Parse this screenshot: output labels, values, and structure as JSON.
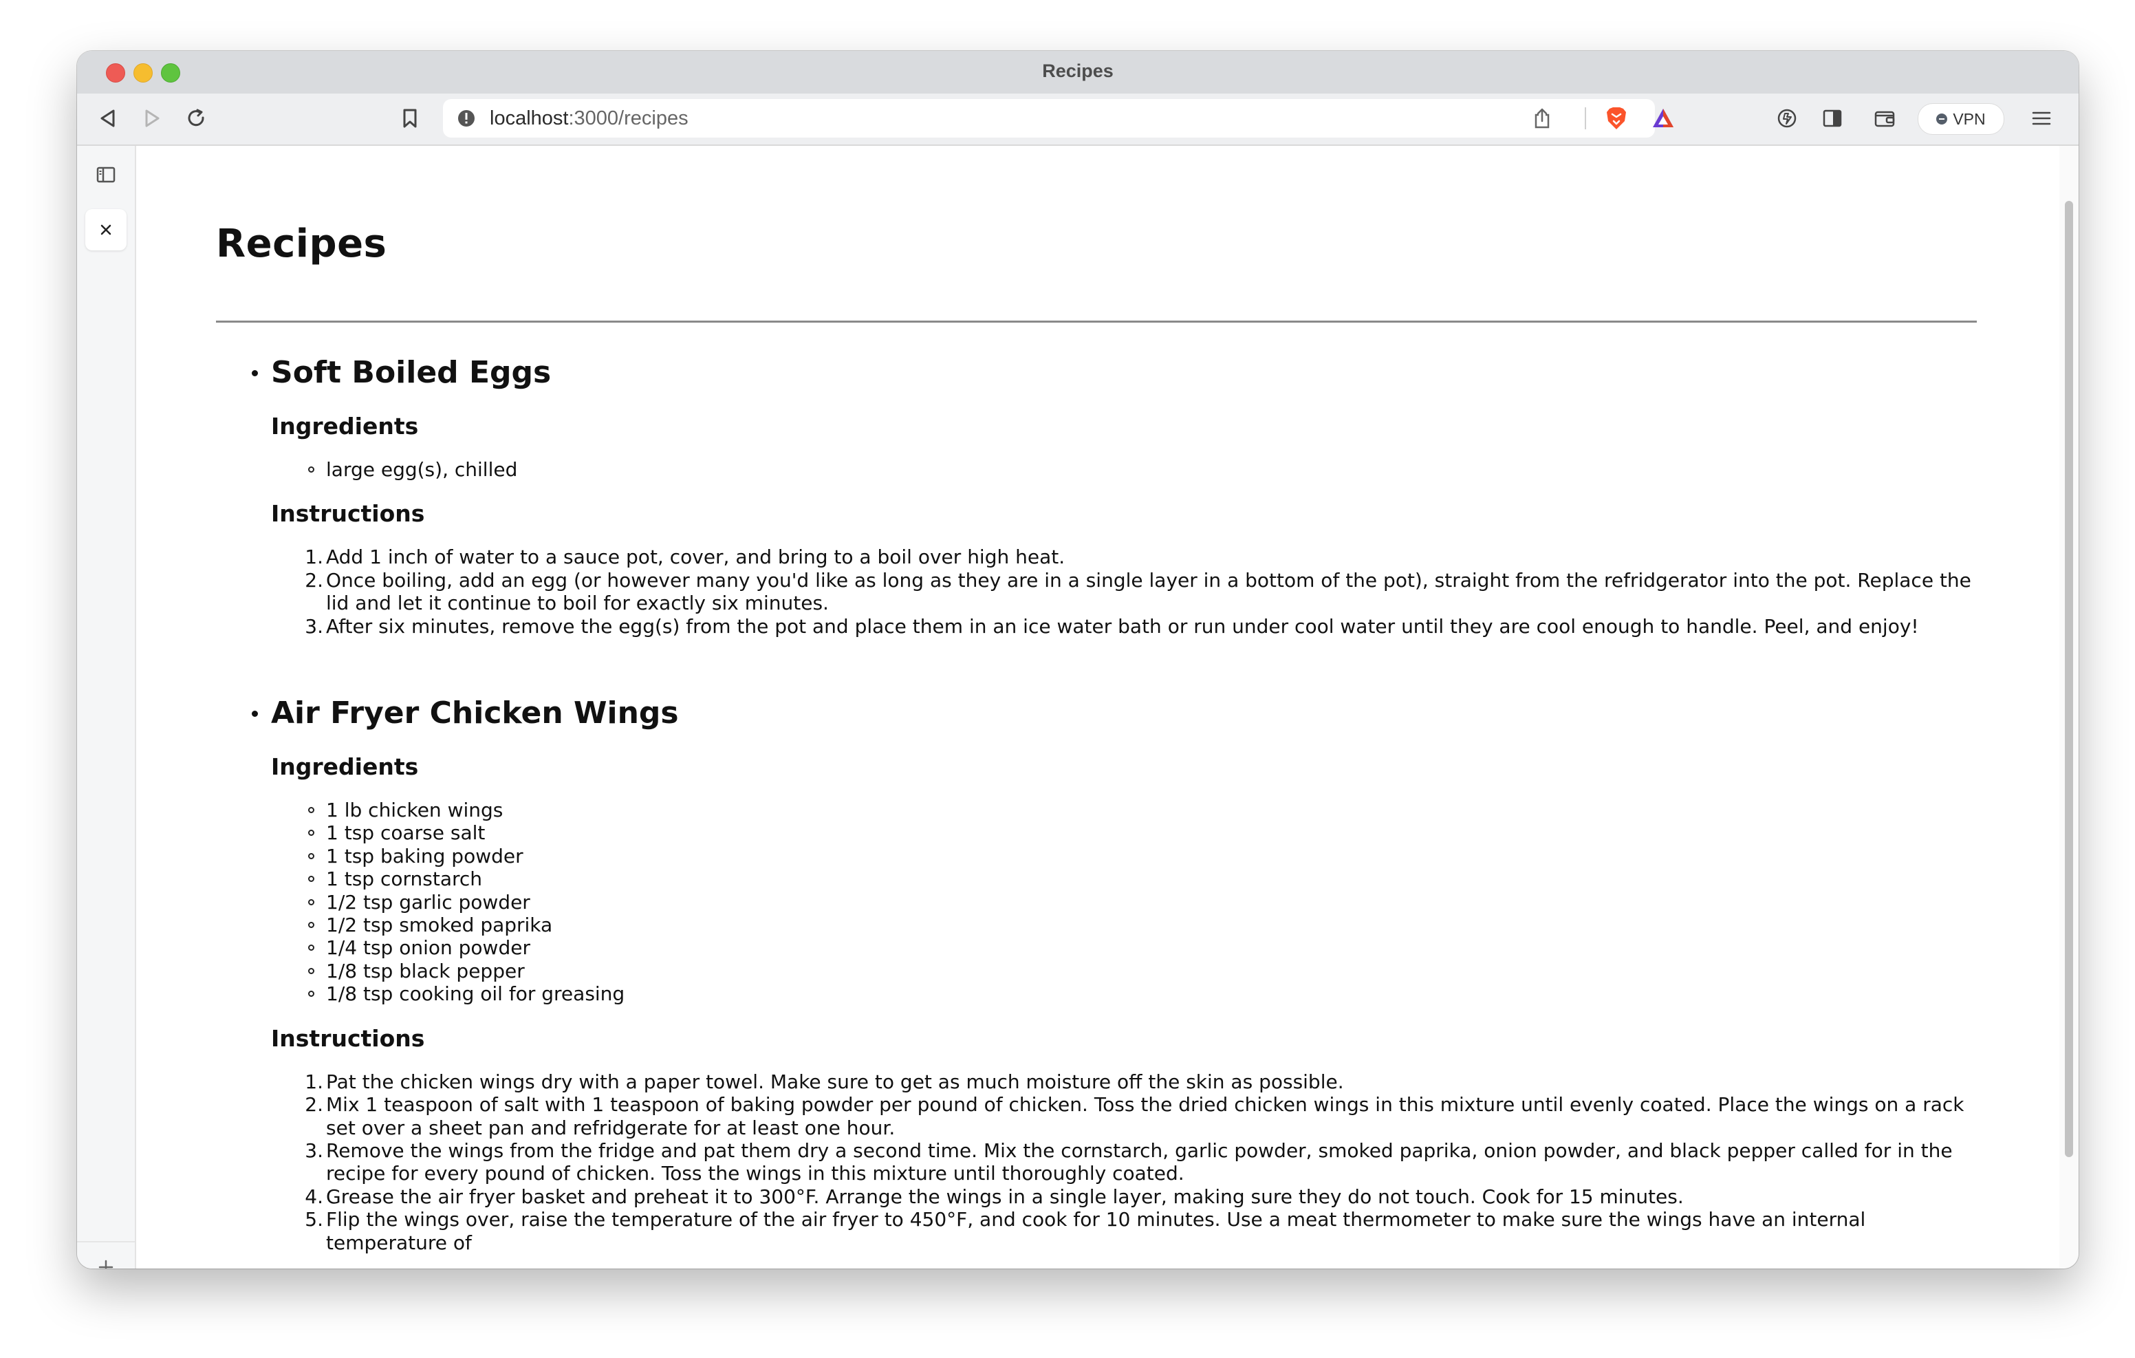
{
  "window": {
    "title": "Recipes"
  },
  "toolbar": {
    "url_host": "localhost",
    "url_rest": ":3000/recipes",
    "vpn_label": "VPN"
  },
  "page": {
    "heading": "Recipes",
    "recipes": [
      {
        "title": "Soft Boiled Eggs",
        "ingredients_heading": "Ingredients",
        "ingredients": [
          "large egg(s), chilled"
        ],
        "instructions_heading": "Instructions",
        "instructions": [
          "Add 1 inch of water to a sauce pot, cover, and bring to a boil over high heat.",
          "Once boiling, add an egg (or however many you'd like as long as they are in a single layer in a bottom of the pot), straight from the refridgerator into the pot. Replace the lid and let it continue to boil for exactly six minutes.",
          "After six minutes, remove the egg(s) from the pot and place them in an ice water bath or run under cool water until they are cool enough to handle. Peel, and enjoy!"
        ]
      },
      {
        "title": "Air Fryer Chicken Wings",
        "ingredients_heading": "Ingredients",
        "ingredients": [
          "1 lb chicken wings",
          "1 tsp coarse salt",
          "1 tsp baking powder",
          "1 tsp cornstarch",
          "1/2 tsp garlic powder",
          "1/2 tsp smoked paprika",
          "1/4 tsp onion powder",
          "1/8 tsp black pepper",
          "1/8 tsp cooking oil for greasing"
        ],
        "instructions_heading": "Instructions",
        "instructions": [
          "Pat the chicken wings dry with a paper towel. Make sure to get as much moisture off the skin as possible.",
          "Mix 1 teaspoon of salt with 1 teaspoon of baking powder per pound of chicken. Toss the dried chicken wings in this mixture until evenly coated. Place the wings on a rack set over a sheet pan and refridgerate for at least one hour.",
          "Remove the wings from the fridge and pat them dry a second time. Mix the cornstarch, garlic powder, smoked paprika, onion powder, and black pepper called for in the recipe for every pound of chicken. Toss the wings in this mixture until thoroughly coated.",
          "Grease the air fryer basket and preheat it to 300°F. Arrange the wings in a single layer, making sure they do not touch. Cook for 15 minutes.",
          "Flip the wings over, raise the temperature of the air fryer to 450°F, and cook for 10 minutes. Use a meat thermometer to make sure the wings have an internal temperature of"
        ]
      }
    ]
  },
  "icons": {
    "back": "back-arrow-icon",
    "forward": "forward-arrow-icon",
    "reload": "reload-icon",
    "bookmark": "bookmark-icon",
    "site_info": "site-info-icon",
    "share": "share-icon",
    "brave_shields": "brave-lion-icon",
    "brave_rewards": "brave-rewards-icon",
    "leo": "leo-ai-icon",
    "sidebar_toggle": "sidebar-toggle-icon",
    "wallet": "wallet-icon",
    "menu": "hamburger-menu-icon"
  },
  "colors": {
    "brave_orange": "#fb542b",
    "url_path": "#666666"
  }
}
